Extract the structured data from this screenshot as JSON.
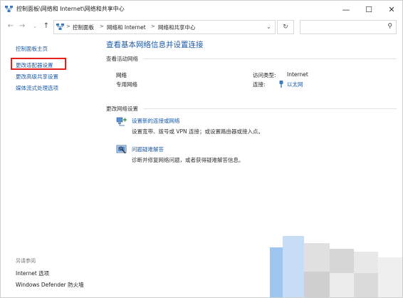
{
  "window": {
    "title": "控制面板\\网络和 Internet\\网络和共享中心",
    "controls": {
      "minimize": "—",
      "maximize": "☐",
      "close": "✕"
    }
  },
  "addressbar": {
    "breadcrumbs": [
      "控制面板",
      "网络和 Internet",
      "网络和共享中心"
    ],
    "separator": ">",
    "search_placeholder": ""
  },
  "sidebar": {
    "items": [
      {
        "label": "控制面板主页"
      },
      {
        "label": "更改适配器设置"
      },
      {
        "label": "更改高级共享设置"
      },
      {
        "label": "媒体流式处理选项"
      }
    ],
    "see_also_label": "另请参阅",
    "see_also_items": [
      {
        "label": "Internet 选项"
      },
      {
        "label": "Windows Defender 防火墙"
      }
    ]
  },
  "main": {
    "title": "查看基本网络信息并设置连接",
    "active_networks_heading": "查看活动网络",
    "network": {
      "name": "网络",
      "category": "专用网络",
      "access_type_label": "访问类型:",
      "access_type_value": "Internet",
      "connections_label": "连接:",
      "connection_value": "以太网"
    },
    "change_settings_heading": "更改网络设置",
    "tasks": [
      {
        "title": "设置新的连接或网络",
        "description": "设置宽带、拨号或 VPN 连接；或设置路由器或接入点。",
        "icon": "network-setup-icon"
      },
      {
        "title": "问题疑难解答",
        "description": "诊断并修复网络问题，或者获得疑难解答信息。",
        "icon": "troubleshoot-icon"
      }
    ]
  },
  "colors": {
    "link": "#1d5aa6",
    "highlight": "#e3201b"
  }
}
